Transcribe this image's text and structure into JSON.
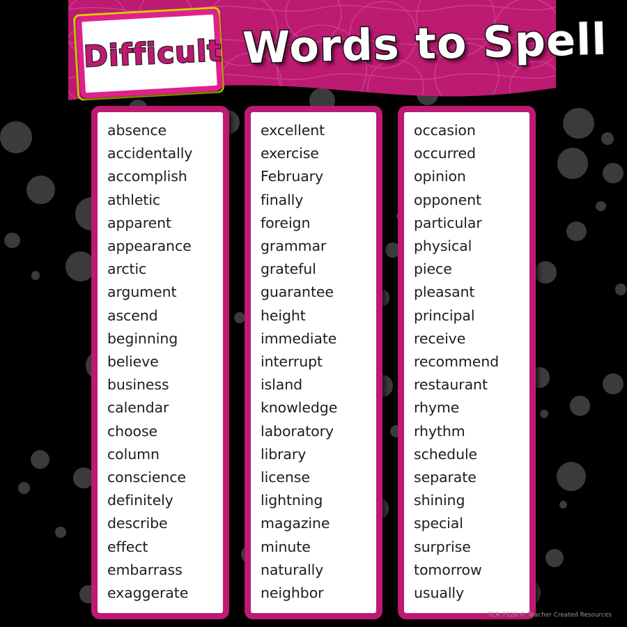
{
  "poster": {
    "header": {
      "badge_label": "Difficult",
      "title": "Words to Spell",
      "banner_color": "#bd1a72",
      "badge_border_color": "#e0208c",
      "badge_text_color": "#bd1a72"
    },
    "background": {
      "color": "#000000",
      "dot_color": "#3b3b3b"
    },
    "panel_border_color": "#bd1a72",
    "panel_background_color": "#ffffff",
    "columns": [
      {
        "name": "column-1",
        "words": [
          "absence",
          "accidentally",
          "accomplish",
          "athletic",
          "apparent",
          "appearance",
          "arctic",
          "argument",
          "ascend",
          "beginning",
          "believe",
          "business",
          "calendar",
          "choose",
          "column",
          "conscience",
          "definitely",
          "describe",
          "effect",
          "embarrass",
          "exaggerate"
        ]
      },
      {
        "name": "column-2",
        "words": [
          "excellent",
          "exercise",
          "February",
          "finally",
          "foreign",
          "grammar",
          "grateful",
          "guarantee",
          "height",
          "immediate",
          "interrupt",
          "island",
          "knowledge",
          "laboratory",
          "library",
          "license",
          "lightning",
          "magazine",
          "minute",
          "naturally",
          "neighbor"
        ]
      },
      {
        "name": "column-3",
        "words": [
          "occasion",
          "occurred",
          "opinion",
          "opponent",
          "particular",
          "physical",
          "piece",
          "pleasant",
          "principal",
          "receive",
          "recommend",
          "restaurant",
          "rhyme",
          "rhythm",
          "schedule",
          "separate",
          "shining",
          "special",
          "surprise",
          "tomorrow",
          "usually"
        ]
      }
    ],
    "footer_credit": "TCR 7728 © Teacher Created Resources"
  }
}
